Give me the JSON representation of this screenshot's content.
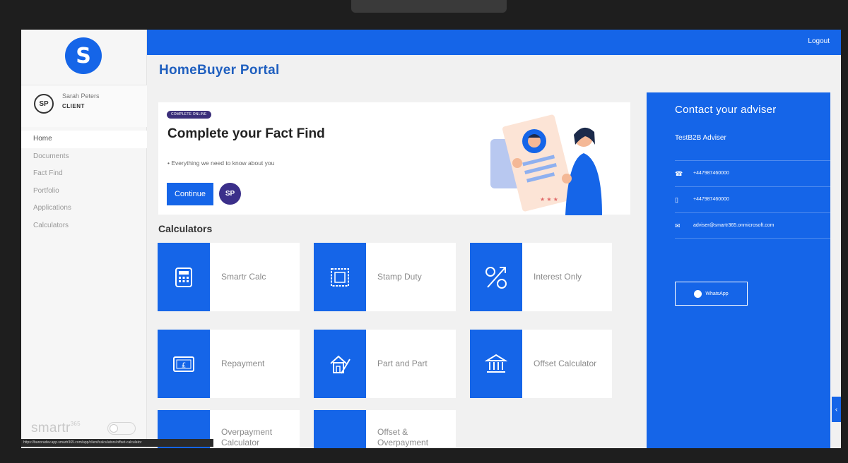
{
  "header": {
    "logout_label": "Logout",
    "portal_title": "HomeBuyer Portal"
  },
  "sidebar": {
    "logo_letter": "S",
    "user": {
      "initials": "SP",
      "name": "Sarah Peters",
      "role": "CLIENT"
    },
    "items": [
      {
        "label": "Home",
        "active": true
      },
      {
        "label": "Documents"
      },
      {
        "label": "Fact Find"
      },
      {
        "label": "Portfolio"
      },
      {
        "label": "Applications"
      },
      {
        "label": "Calculators"
      }
    ],
    "brand": "smartr",
    "brand_sup": "365"
  },
  "fact_find": {
    "badge": "COMPLETE ONLINE",
    "title": "Complete your Fact Find",
    "bullet": "• Everything we need to know about you",
    "continue_label": "Continue",
    "avatar_initials": "SP"
  },
  "calculators": {
    "heading": "Calculators",
    "tiles": [
      {
        "label": "Smartr Calc",
        "icon": "calculator-icon"
      },
      {
        "label": "Stamp Duty",
        "icon": "stamp-icon"
      },
      {
        "label": "Interest Only",
        "icon": "percent-icon"
      },
      {
        "label": "Repayment",
        "icon": "banknote-icon"
      },
      {
        "label": "Part and Part",
        "icon": "house-icon"
      },
      {
        "label": "Offset Calculator",
        "icon": "bank-icon"
      },
      {
        "label": "Overpayment Calculator",
        "icon": "coin-icon"
      },
      {
        "label": "Offset & Overpayment",
        "icon": "house-arrow-icon"
      }
    ]
  },
  "adviser": {
    "title": "Contact your adviser",
    "name": "TestB2B Adviser",
    "phone": "+447987460000",
    "mobile": "+447987460000",
    "email": "adviser@smartr365.onmicrosoft.com",
    "whatsapp_label": "WhatsApp"
  },
  "status_bar": {
    "url": "https://banoradev.app.smartr365.com/app/client/calculators/offset-calculator"
  },
  "colors": {
    "primary": "#1565e8",
    "badge": "#3b2f7a",
    "sidebar_bg": "#f6f6f6"
  }
}
